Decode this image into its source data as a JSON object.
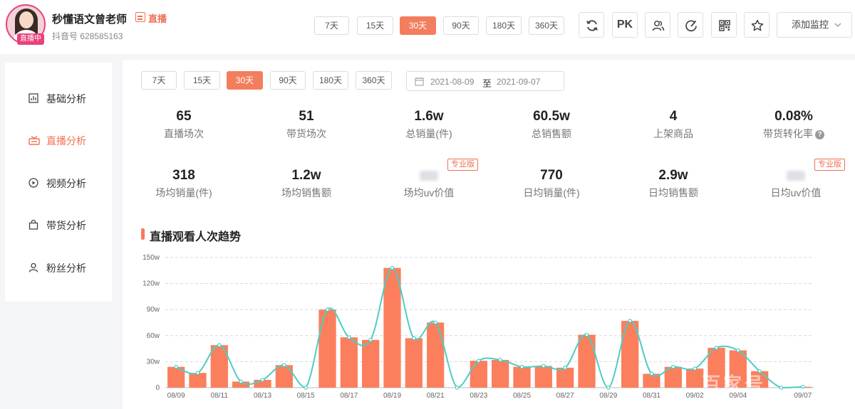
{
  "header": {
    "name": "秒懂语文曾老师",
    "live_tag": "直播",
    "account": "抖音号 628585163",
    "live_badge": "直播中",
    "periods": [
      "7天",
      "15天",
      "30天",
      "90天",
      "180天",
      "360天"
    ],
    "active_period": "30天",
    "pk_label": "PK",
    "monitor_label": "添加监控",
    "icons": [
      "refresh-icon",
      "pk-icon",
      "users-icon",
      "edit-circle-icon",
      "qrcode-icon",
      "star-icon",
      "chevron-down-icon"
    ]
  },
  "sidebar": {
    "items": [
      {
        "label": "基础分析",
        "icon": "bar-chart-icon"
      },
      {
        "label": "直播分析",
        "icon": "live-icon"
      },
      {
        "label": "视频分析",
        "icon": "play-circle-icon"
      },
      {
        "label": "带货分析",
        "icon": "shopping-bag-icon"
      },
      {
        "label": "粉丝分析",
        "icon": "user-icon"
      }
    ],
    "active_index": 1
  },
  "filters": {
    "periods": [
      "7天",
      "15天",
      "30天",
      "90天",
      "180天",
      "360天"
    ],
    "active_period": "30天",
    "date_start": "2021-08-09",
    "date_sep": "至",
    "date_end": "2021-09-07"
  },
  "stats_row1": [
    {
      "value": "65",
      "label": "直播场次"
    },
    {
      "value": "51",
      "label": "带货场次"
    },
    {
      "value": "1.6w",
      "label": "总销量(件)"
    },
    {
      "value": "60.5w",
      "label": "总销售额"
    },
    {
      "value": "4",
      "label": "上架商品"
    },
    {
      "value": "0.08%",
      "label": "带货转化率"
    }
  ],
  "stats_row2": [
    {
      "value": "318",
      "label": "场均销量(件)"
    },
    {
      "value": "1.2w",
      "label": "场均销售额"
    },
    {
      "value": "",
      "label": "场均uv价值",
      "pro": "专业版"
    },
    {
      "value": "770",
      "label": "日均销量(件)"
    },
    {
      "value": "2.9w",
      "label": "日均销售额"
    },
    {
      "value": "",
      "label": "日均uv价值",
      "pro": "专业版"
    }
  ],
  "section_title": "直播观看人次趋势",
  "watermark": "百家号",
  "chart_data": {
    "type": "bar",
    "title": "直播观看人次趋势",
    "categories": [
      "08/09",
      "08/10",
      "08/11",
      "08/12",
      "08/13",
      "08/14",
      "08/15",
      "08/16",
      "08/17",
      "08/18",
      "08/19",
      "08/20",
      "08/21",
      "08/22",
      "08/23",
      "08/24",
      "08/25",
      "08/26",
      "08/27",
      "08/28",
      "08/29",
      "08/30",
      "08/31",
      "09/01",
      "09/02",
      "09/03",
      "09/04",
      "09/05",
      "09/06",
      "09/07"
    ],
    "x_tick_labels": [
      "08/09",
      "08/11",
      "08/13",
      "08/15",
      "08/17",
      "08/19",
      "08/21",
      "08/23",
      "08/25",
      "08/27",
      "08/29",
      "08/31",
      "09/02",
      "09/04",
      "09/07"
    ],
    "values": [
      24,
      17,
      49,
      7,
      9,
      26,
      0,
      90,
      58,
      55,
      138,
      57,
      75,
      0,
      31,
      32,
      24,
      25,
      23,
      61,
      0,
      77,
      16,
      24,
      22,
      46,
      43,
      19,
      0,
      1
    ],
    "y_tick_labels": [
      "0",
      "30w",
      "60w",
      "90w",
      "120w",
      "150w"
    ],
    "ylim": [
      0,
      150
    ],
    "unit": "w",
    "grid": true,
    "colors": {
      "bar": "#fb7f5c",
      "line": "#4ecdc4"
    }
  }
}
